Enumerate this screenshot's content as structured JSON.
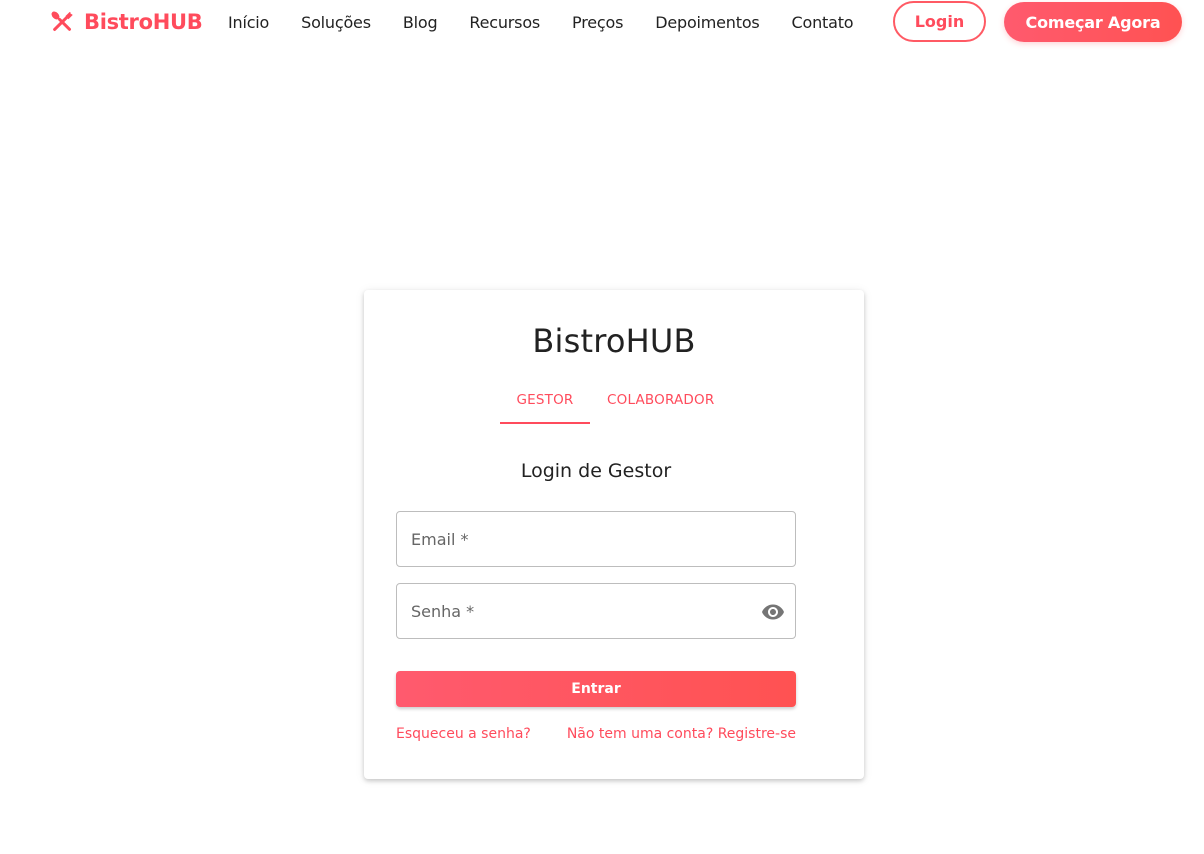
{
  "brand": {
    "name": "BistroHUB",
    "accent_color": "#ff4b5c",
    "icon": "utensils-crossed-icon"
  },
  "nav": {
    "items": [
      {
        "label": "Início"
      },
      {
        "label": "Soluções"
      },
      {
        "label": "Blog"
      },
      {
        "label": "Recursos"
      },
      {
        "label": "Preços"
      },
      {
        "label": "Depoimentos"
      },
      {
        "label": "Contato"
      }
    ],
    "login_label": "Login",
    "cta_label": "Começar Agora"
  },
  "card": {
    "title": "BistroHUB",
    "tabs": [
      {
        "label": "GESTOR",
        "active": true
      },
      {
        "label": "COLABORADOR",
        "active": false
      }
    ],
    "subtitle": "Login de Gestor",
    "email": {
      "placeholder": "Email *",
      "value": ""
    },
    "password": {
      "placeholder": "Senha *",
      "value": "",
      "toggle_icon": "eye-icon"
    },
    "submit_label": "Entrar",
    "forgot_label": "Esqueceu a senha?",
    "register_label": "Não tem uma conta? Registre-se"
  }
}
